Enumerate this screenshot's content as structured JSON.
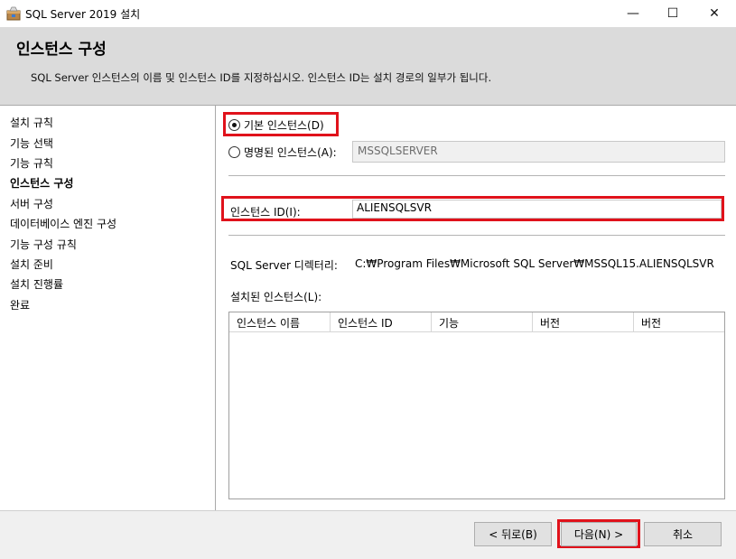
{
  "window": {
    "title": "SQL Server 2019 설치",
    "minimize": "—",
    "maximize": "☐",
    "close": "✕"
  },
  "header": {
    "title": "인스턴스 구성",
    "description": "SQL Server 인스턴스의 이름 및 인스턴스 ID를 지정하십시오. 인스턴스 ID는 설치 경로의 일부가 됩니다."
  },
  "sidebar": {
    "items": [
      {
        "label": "설치 규칙"
      },
      {
        "label": "기능 선택"
      },
      {
        "label": "기능 규칙"
      },
      {
        "label": "인스턴스 구성",
        "active": true
      },
      {
        "label": "서버 구성"
      },
      {
        "label": "데이터베이스 엔진 구성"
      },
      {
        "label": "기능 구성 규칙"
      },
      {
        "label": "설치 준비"
      },
      {
        "label": "설치 진행률"
      },
      {
        "label": "완료"
      }
    ]
  },
  "instance": {
    "default_radio_label": "기본 인스턴스(D)",
    "named_radio_label": "명명된 인스턴스(A):",
    "named_value": "MSSQLSERVER",
    "id_label": "인스턴스 ID(I):",
    "id_value": "ALIENSQLSVR",
    "dir_label": "SQL Server 디렉터리:",
    "dir_value": "C:₩Program Files₩Microsoft SQL Server₩MSSQL15.ALIENSQLSVR",
    "installed_label": "설치된 인스턴스(L):"
  },
  "table": {
    "columns": [
      "인스턴스 이름",
      "인스턴스 ID",
      "기능",
      "버전",
      "버전"
    ],
    "rows": []
  },
  "footer": {
    "back_label": "< 뒤로(B)",
    "next_label": "다음(N) >",
    "cancel_label": "취소"
  },
  "colors": {
    "highlight": "#e0121b",
    "header_bg": "#dbdbdb"
  }
}
